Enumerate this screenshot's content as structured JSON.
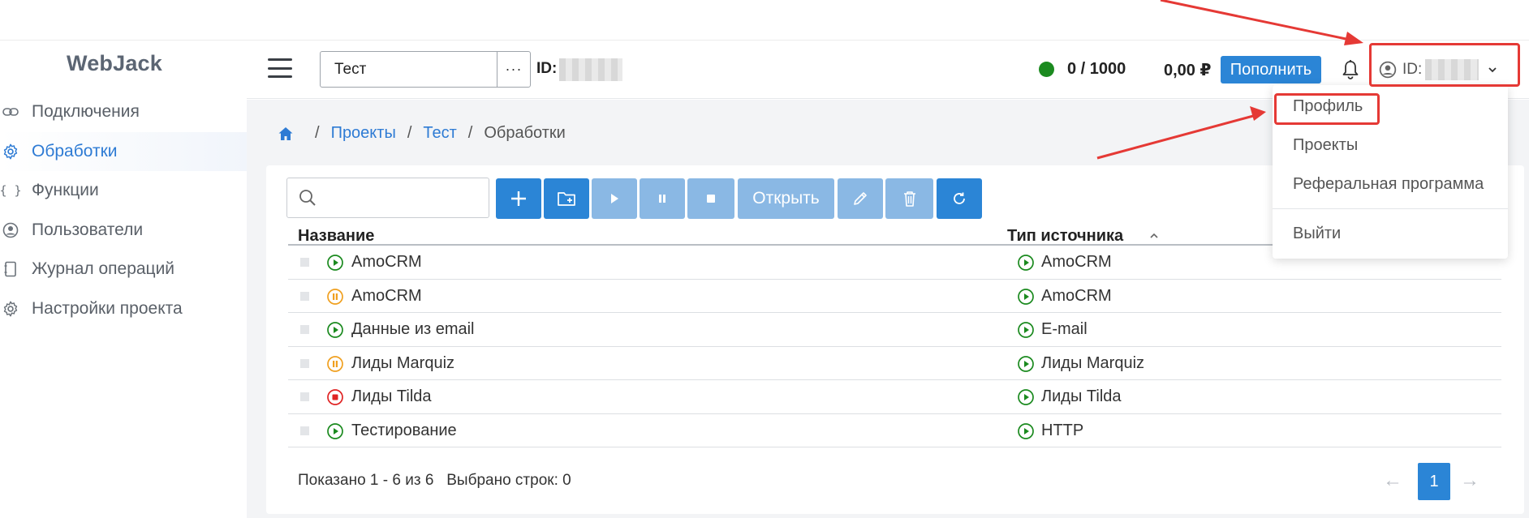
{
  "app": {
    "logo": "WebJack"
  },
  "sidebar": {
    "items": [
      {
        "label": "Подключения",
        "icon": "link-icon",
        "active": false
      },
      {
        "label": "Обработки",
        "icon": "gear-icon",
        "active": true
      },
      {
        "label": "Функции",
        "icon": "braces-icon",
        "active": false
      },
      {
        "label": "Пользователи",
        "icon": "user-icon",
        "active": false
      },
      {
        "label": "Журнал операций",
        "icon": "notebook-icon",
        "active": false
      },
      {
        "label": "Настройки проекта",
        "icon": "gear-icon",
        "active": false
      }
    ]
  },
  "header": {
    "project_value": "Тест",
    "more_label": "···",
    "id_label": "ID:",
    "quota": "0 / 1000",
    "balance": "0,00 ₽",
    "topup_label": "Пополнить",
    "user_id_label": "ID: "
  },
  "breadcrumb": {
    "items": [
      "Проекты",
      "Тест"
    ],
    "current": "Обработки"
  },
  "toolbar": {
    "search_placeholder": "",
    "open_label": "Открыть"
  },
  "table": {
    "columns": [
      "Название",
      "Тип источника"
    ],
    "rows": [
      {
        "status": "running",
        "name": "AmoCRM",
        "source": "AmoCRM"
      },
      {
        "status": "paused",
        "name": "AmoCRM",
        "source": "AmoCRM"
      },
      {
        "status": "running",
        "name": "Данные из email",
        "source": "E-mail"
      },
      {
        "status": "paused",
        "name": "Лиды Marquiz",
        "source": "Лиды Marquiz"
      },
      {
        "status": "stopped",
        "name": "Лиды Tilda",
        "source": "Лиды Tilda"
      },
      {
        "status": "running",
        "name": "Тестирование",
        "source": "HTTP"
      }
    ],
    "footer_shown": "Показано 1 - 6 из 6",
    "footer_selected": "Выбрано строк: 0"
  },
  "pagination": {
    "prev": "←",
    "current": "1",
    "next": "→"
  },
  "user_menu": {
    "items": [
      "Профиль",
      "Проекты",
      "Реферальная программа"
    ],
    "logout": "Выйти"
  },
  "colors": {
    "accent": "#2b85d6",
    "running": "#1b8a1f",
    "paused": "#f0a020",
    "stopped": "#e02424",
    "annotation": "#e53935"
  }
}
